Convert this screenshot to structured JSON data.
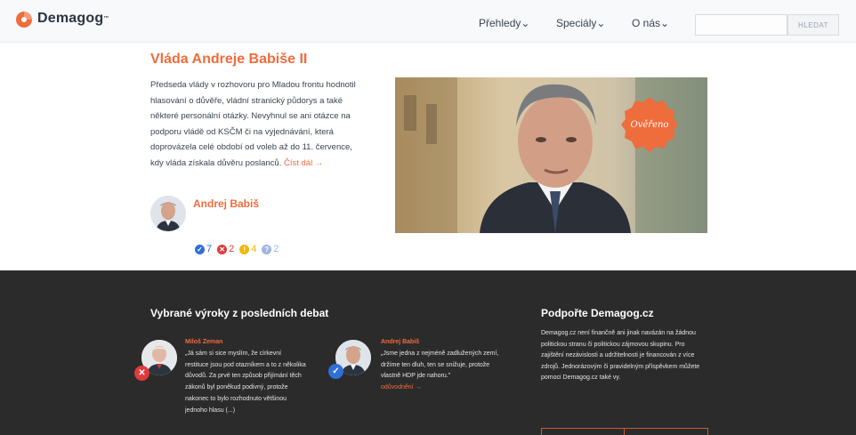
{
  "header": {
    "logo_text": "Demagog",
    "logo_tm": "™",
    "logo_tagline": "",
    "nav": [
      {
        "label": "Přehledy"
      },
      {
        "label": "Speciály"
      },
      {
        "label": "O nás"
      }
    ],
    "search_placeholder": "",
    "search_button": "HLEDAT"
  },
  "feature": {
    "title": "Vláda Andreje Babiše II",
    "text": "Předseda vlády v rozhovoru pro Mladou frontu hodnotil hlasování o důvěře, vládní stranický půdorys a také některé personální otázky. Nevyhnul se ani otázce na podporu vládě od KSČM či na vyjednávání, která doprovázela celé období od voleb až do 11. července, kdy vláda získala důvěru poslanců.",
    "read_more": "Číst dál →",
    "person": "Andrej Babiš",
    "badge": "Ověřeno",
    "stats": [
      {
        "value": "7",
        "color": "#2f6fd6",
        "icon": "check"
      },
      {
        "value": "2",
        "color": "#e03a3a",
        "icon": "cross"
      },
      {
        "value": "4",
        "color": "#f2b705",
        "icon": "exclamation"
      },
      {
        "value": "2",
        "color": "#9fb6e0",
        "icon": "question"
      }
    ]
  },
  "debates": {
    "title": "Vybrané výroky z posledních debat",
    "quotes": [
      {
        "name": "Miloš Zeman",
        "text": "„Já sám si sice myslím, že církevní restituce jsou pod otazníkem a to z několika důvodů. Za prvé ten způsob přijímání těch zákonů byl poněkud podivný, protože nakonec to bylo rozhodnuto většinou jednoho hlasu (...)",
        "verdict": "cross",
        "verdict_color": "#e03a3a"
      },
      {
        "name": "Andrej Babiš",
        "text": "„Jsme jedna z nejméně zadlužených zemí, držíme ten dluh, ten se snižuje, protože vlastně HDP jde nahoru.\"",
        "link": "odůvodnění →",
        "verdict": "check",
        "verdict_color": "#2f6fd6"
      }
    ]
  },
  "support": {
    "title": "Podpořte Demagog.cz",
    "text": "Demagog.cz není finančně ani jinak navázán na žádnou politickou stranu či politickou zájmovou skupinu. Pro zajištění nezávislosti a udržitelnosti je financován z více zdrojů. Jednorázovým či pravidelným příspěvkem můžete pomoci Demagog.cz také vy."
  },
  "colors": {
    "accent": "#ef6c3c",
    "dark_bg": "#2b2b2b",
    "header_bg": "#f7f9fb"
  }
}
